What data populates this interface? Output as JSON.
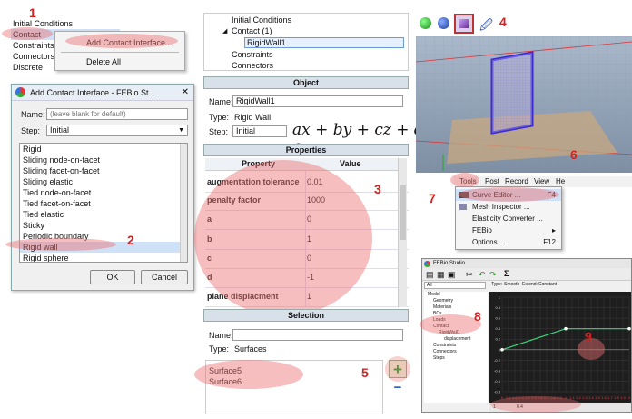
{
  "step_numbers": [
    "1",
    "2",
    "3",
    "4",
    "5",
    "6",
    "7",
    "8",
    "9"
  ],
  "panel1": {
    "tree": [
      "Initial Conditions",
      "Contact",
      "Constraints",
      "Connectors",
      "Discrete"
    ],
    "menu": [
      "Add Contact Interface ...",
      "Delete All"
    ]
  },
  "dialog": {
    "title": "Add Contact Interface - FEBio St...",
    "name_label": "Name:",
    "name_placeholder": "(leave blank for default)",
    "step_label": "Step:",
    "step_value": "Initial",
    "types": [
      "Rigid",
      "Sliding node-on-facet",
      "Sliding facet-on-facet",
      "Sliding elastic",
      "Tied node-on-facet",
      "Tied facet-on-facet",
      "Tied elastic",
      "Sticky",
      "Periodic boundary",
      "Rigid wall",
      "Rigid sphere"
    ],
    "ok": "OK",
    "cancel": "Cancel"
  },
  "model_tree": {
    "items": [
      "Initial Conditions",
      "Contact (1)",
      "RigidWall1",
      "Constraints",
      "Connectors"
    ]
  },
  "object_panel": {
    "header": "Object",
    "name_label": "Name:",
    "name_value": "RigidWall1",
    "type_label": "Type:",
    "type_value": "Rigid Wall",
    "step_label": "Step:",
    "step_value": "Initial"
  },
  "equation": "ax + by + cz + d = 0",
  "properties": {
    "header": "Properties",
    "col_property": "Property",
    "col_value": "Value",
    "rows": [
      {
        "k": "augmentation tolerance",
        "v": "0.01"
      },
      {
        "k": "penalty factor",
        "v": "1000"
      },
      {
        "k": "a",
        "v": "0"
      },
      {
        "k": "b",
        "v": "1"
      },
      {
        "k": "c",
        "v": "0"
      },
      {
        "k": "d",
        "v": "-1"
      },
      {
        "k": "plane displacment",
        "v": "1"
      }
    ]
  },
  "selection": {
    "header": "Selection",
    "name_label": "Name:",
    "type_label": "Type:",
    "type_value": "Surfaces",
    "items": [
      "Surface5",
      "Surface6"
    ],
    "add": "+",
    "remove": "−"
  },
  "menubar": {
    "items": [
      "Tools",
      "Post",
      "Record",
      "View",
      "He"
    ],
    "tools_menu": [
      {
        "label": "Curve Editor ...",
        "shortcut": "F4"
      },
      {
        "label": "Mesh Inspector ...",
        "shortcut": ""
      },
      {
        "label": "Elasticity Converter ...",
        "shortcut": ""
      },
      {
        "label": "FEBio",
        "shortcut": "▸"
      },
      {
        "label": "Options ...",
        "shortcut": "F12"
      }
    ]
  },
  "febio_window": {
    "title": "FEBio Studio",
    "combo_all": "All",
    "type_label": "Type:",
    "type_value": "Smooth",
    "extend_label": "Extend:",
    "extend_value": "Constant",
    "tree": [
      "Model",
      "Geometry",
      "Materials",
      "BCs",
      "Loads",
      "Contact",
      "RigidWall1",
      "displacement",
      "Constraints",
      "Connectors",
      "Steps"
    ],
    "curve_points": [
      [
        0,
        0
      ],
      [
        1,
        0.4
      ],
      [
        2,
        0.4
      ]
    ],
    "y_ticks": [
      "1",
      "0.8",
      "0.6",
      "0.4",
      "0.2",
      "0",
      "-0.2",
      "-0.4",
      "-0.6",
      "-0.8"
    ],
    "x_ticks": [
      "0",
      "0.1",
      "0.2",
      "0.3",
      "0.4",
      "0.5",
      "0.6",
      "0.7",
      "0.8",
      "0.9",
      "1",
      "1.1",
      "1.2",
      "1.3",
      "1.4",
      "1.5",
      "1.6",
      "1.7",
      "1.8",
      "1.9",
      "2"
    ],
    "status_left": "1",
    "status_right": "0.4"
  },
  "colors": {
    "annotation_red": "#d42020",
    "highlight": "#eb6e6e",
    "plot_bg": "#1e1e1e",
    "curve": "#3cd67a"
  }
}
